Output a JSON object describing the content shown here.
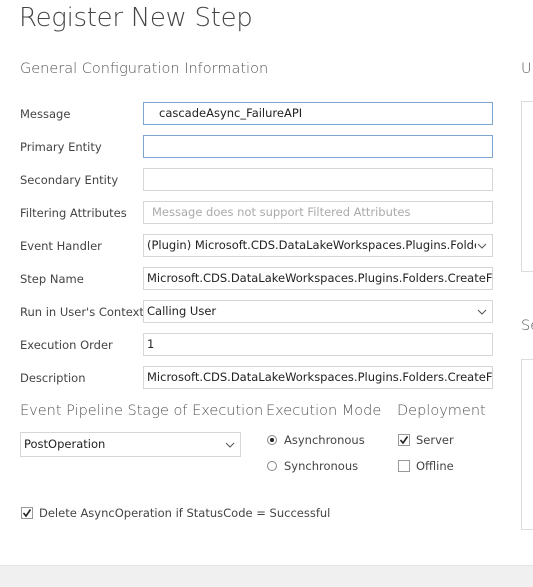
{
  "dialog": {
    "title": "Register New Step",
    "section_title": "General Configuration Information"
  },
  "fields": {
    "message": {
      "label": "Message",
      "value": "cascadeAsync_FailureAPI"
    },
    "primary_entity": {
      "label": "Primary Entity",
      "value": ""
    },
    "secondary_entity": {
      "label": "Secondary Entity",
      "value": ""
    },
    "filtering_attributes": {
      "label": "Filtering Attributes",
      "placeholder": "Message does not support Filtered Attributes"
    },
    "event_handler": {
      "label": "Event Handler",
      "value": "(Plugin) Microsoft.CDS.DataLakeWorkspaces.Plugins.Folders.C"
    },
    "step_name": {
      "label": "Step Name",
      "value": "Microsoft.CDS.DataLakeWorkspaces.Plugins.Folders.CreateFolderA"
    },
    "run_in_user_context": {
      "label": "Run in User's Context",
      "value": "Calling User"
    },
    "execution_order": {
      "label": "Execution Order",
      "value": "1"
    },
    "description": {
      "label": "Description",
      "value": "Microsoft.CDS.DataLakeWorkspaces.Plugins.Folders.CreateFolderA"
    }
  },
  "pipeline": {
    "heading": "Event Pipeline Stage of Execution",
    "value": "PostOperation"
  },
  "execution_mode": {
    "heading": "Execution Mode",
    "options": [
      {
        "label": "Asynchronous",
        "selected": true
      },
      {
        "label": "Synchronous",
        "selected": false
      }
    ]
  },
  "deployment": {
    "heading": "Deployment",
    "options": [
      {
        "label": "Server",
        "checked": true
      },
      {
        "label": "Offline",
        "checked": false
      }
    ]
  },
  "delete_async": {
    "label": "Delete AsyncOperation if StatusCode = Successful",
    "checked": true
  },
  "side_panels": {
    "top_title": "Un",
    "bottom_title": "Se"
  }
}
